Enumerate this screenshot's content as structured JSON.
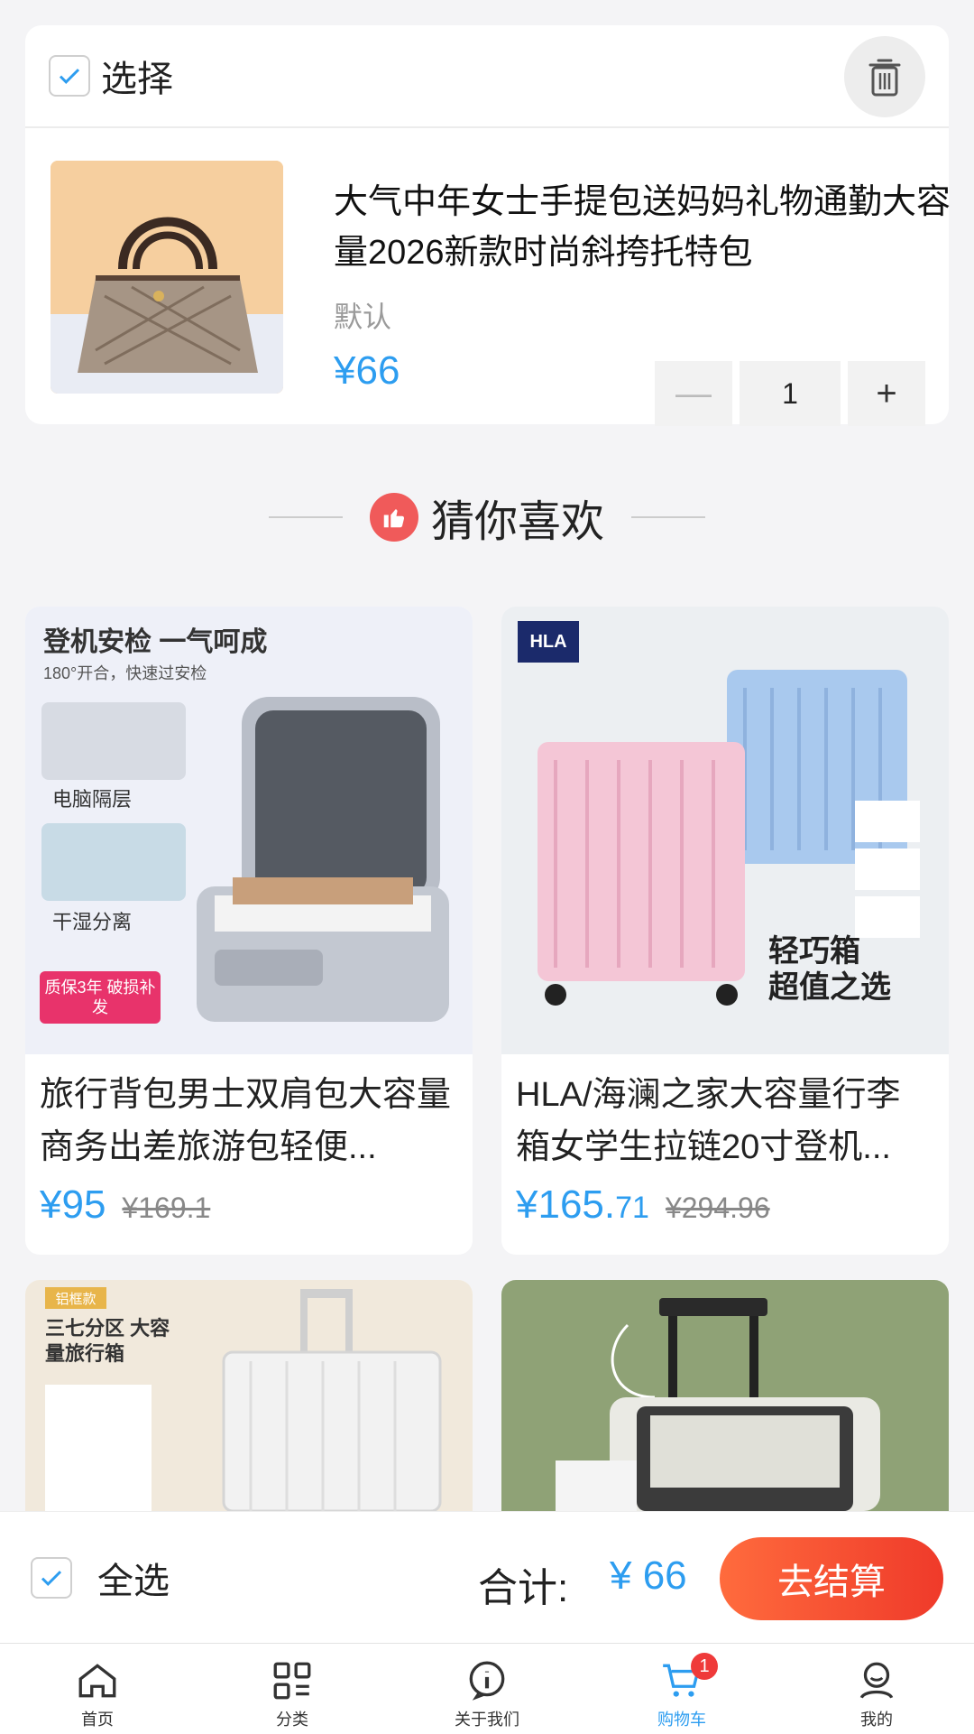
{
  "cart": {
    "select_label": "选择",
    "item": {
      "title": "大气中年女士手提包送妈妈礼物通勤大容量2026新款时尚斜挎托特包",
      "spec": "默认",
      "price": "¥66",
      "quantity": "1"
    }
  },
  "recommend": {
    "title": "猜你喜欢",
    "products": [
      {
        "name": "旅行背包男士双肩包大容量商务出差旅游包轻便...",
        "price_int": "¥95",
        "price_dec": "",
        "orig_price": "¥169.1",
        "img_text": {
          "headline": "登机安检 一气呵成",
          "sub": "180°开合，快速过安检",
          "f1": "电脑隔层",
          "f2": "干湿分离",
          "badge": "质保3年 破损补发"
        }
      },
      {
        "name": "HLA/海澜之家大容量行李箱女学生拉链20寸登机...",
        "price_int": "¥165.",
        "price_dec": "71",
        "orig_price": "¥294.96",
        "img_text": {
          "brand": "HLA",
          "slogan1": "轻巧箱",
          "slogan2": "超值之选"
        }
      },
      {
        "img_text": {
          "tag": "铝框款",
          "headline": "三七分区 大容量旅行箱"
        }
      },
      {}
    ]
  },
  "checkout": {
    "select_all_label": "全选",
    "total_label": "合计:",
    "total_value": "¥ 66",
    "pay_label": "去结算"
  },
  "tabbar": {
    "items": [
      {
        "label": "首页",
        "icon": "home-icon"
      },
      {
        "label": "分类",
        "icon": "category-icon"
      },
      {
        "label": "关于我们",
        "icon": "info-icon"
      },
      {
        "label": "购物车",
        "icon": "cart-icon",
        "badge": "1",
        "active": true
      },
      {
        "label": "我的",
        "icon": "user-icon"
      }
    ]
  },
  "colors": {
    "accent": "#2d9df0",
    "pay_start": "#ff6b3d",
    "pay_end": "#ef3a2a",
    "badge": "#ef3a3a"
  }
}
